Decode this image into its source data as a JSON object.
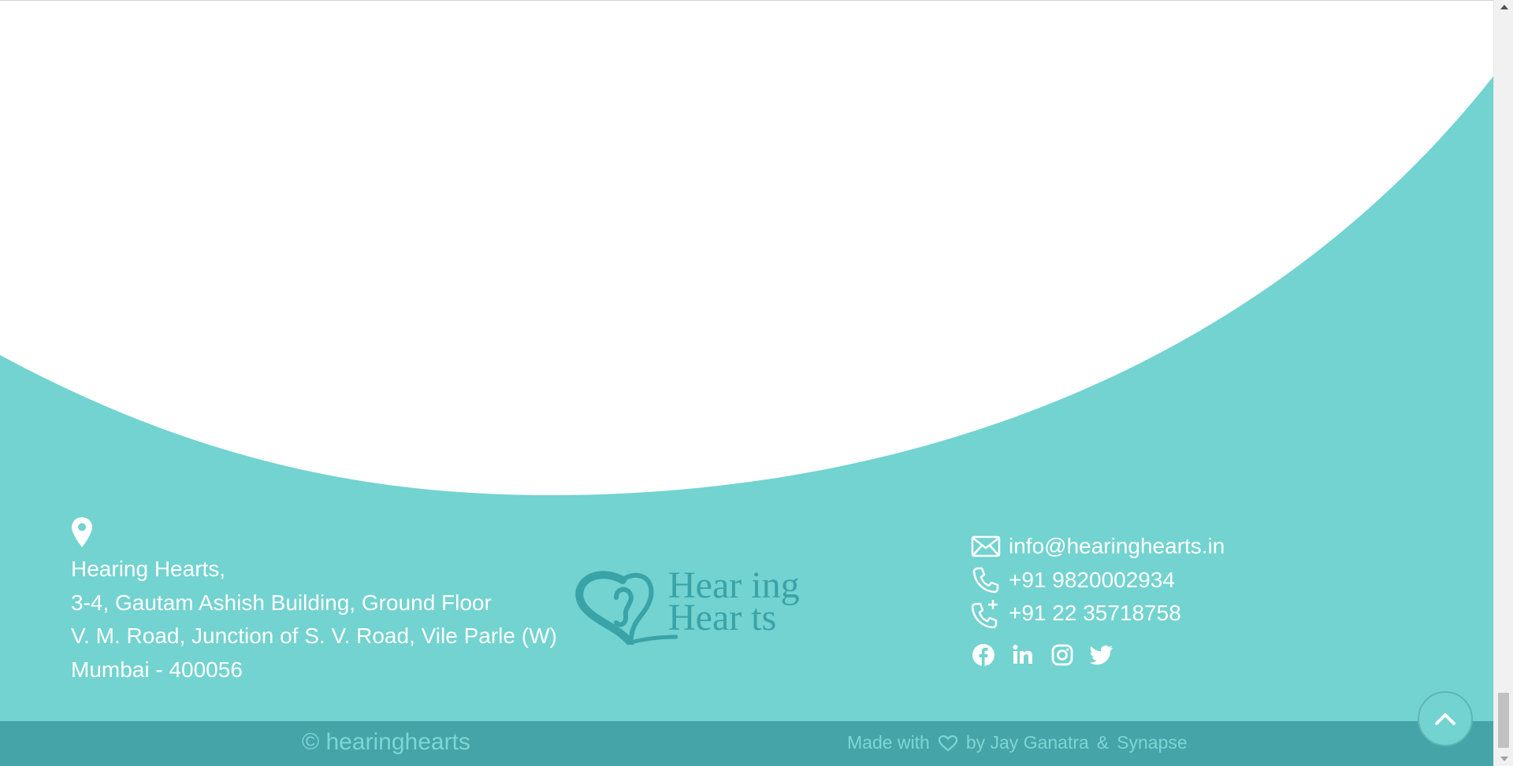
{
  "colors": {
    "teal": "#72d3d0",
    "dark_teal": "#44a4a8",
    "logo_teal": "#3aa3a8",
    "bar_text": "#7ad7d5",
    "white": "#ffffff"
  },
  "address": {
    "icon": "map-pin-icon",
    "lines": [
      "Hearing Hearts,",
      "3-4, Gautam Ashish Building, Ground Floor",
      "V. M. Road, Junction of S. V. Road, Vile Parle (W)",
      "Mumbai - 400056"
    ]
  },
  "logo": {
    "line1": "Hear ing",
    "line2": "Hear ts"
  },
  "contact": {
    "email": {
      "icon": "envelope-icon",
      "text": "info@hearinghearts.in"
    },
    "phone": {
      "icon": "phone-icon",
      "text": "+91 9820002934"
    },
    "phone2": {
      "icon": "phone-plus-icon",
      "text": "+91 22 35718758"
    }
  },
  "social": [
    "facebook-icon",
    "linkedin-icon",
    "instagram-icon",
    "twitter-icon"
  ],
  "footer_bar": {
    "copyright": "© hearinghearts",
    "made_with": "Made with",
    "heart_icon": "heart-icon",
    "by": "by Jay Ganatra",
    "amp": "&",
    "synapse": "Synapse"
  },
  "scroll_top_icon": "chevron-up-icon"
}
